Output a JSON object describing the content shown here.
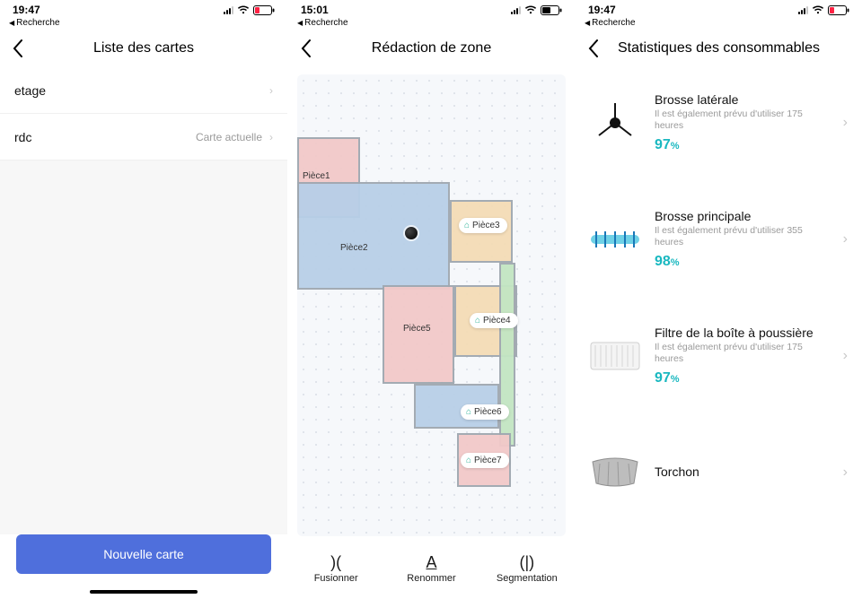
{
  "screens": {
    "maps": {
      "status_time": "19:47",
      "breadcrumb": "Recherche",
      "title": "Liste des cartes",
      "rows": [
        {
          "label": "etage",
          "trail": ""
        },
        {
          "label": "rdc",
          "trail": "Carte actuelle"
        }
      ],
      "primary_button": "Nouvelle carte"
    },
    "editor": {
      "status_time": "15:01",
      "breadcrumb": "Recherche",
      "title": "Rédaction de zone",
      "rooms": [
        "Pièce1",
        "Pièce2",
        "Pièce3",
        "Pièce4",
        "Pièce5",
        "Pièce6",
        "Pièce7"
      ],
      "tools": [
        {
          "label": "Fusionner"
        },
        {
          "label": "Renommer"
        },
        {
          "label": "Segmentation"
        }
      ]
    },
    "consumables": {
      "status_time": "19:47",
      "breadcrumb": "Recherche",
      "title": "Statistiques des consommables",
      "items": [
        {
          "title": "Brosse latérale",
          "sub": "Il est également prévu d'utiliser 175 heures",
          "pct": "97"
        },
        {
          "title": "Brosse principale",
          "sub": "Il est également prévu d'utiliser 355 heures",
          "pct": "98"
        },
        {
          "title": "Filtre de la boîte à poussière",
          "sub": "Il est également prévu d'utiliser 175 heures",
          "pct": "97"
        },
        {
          "title": "Torchon",
          "sub": "",
          "pct": ""
        }
      ],
      "pct_sign": "%"
    }
  }
}
